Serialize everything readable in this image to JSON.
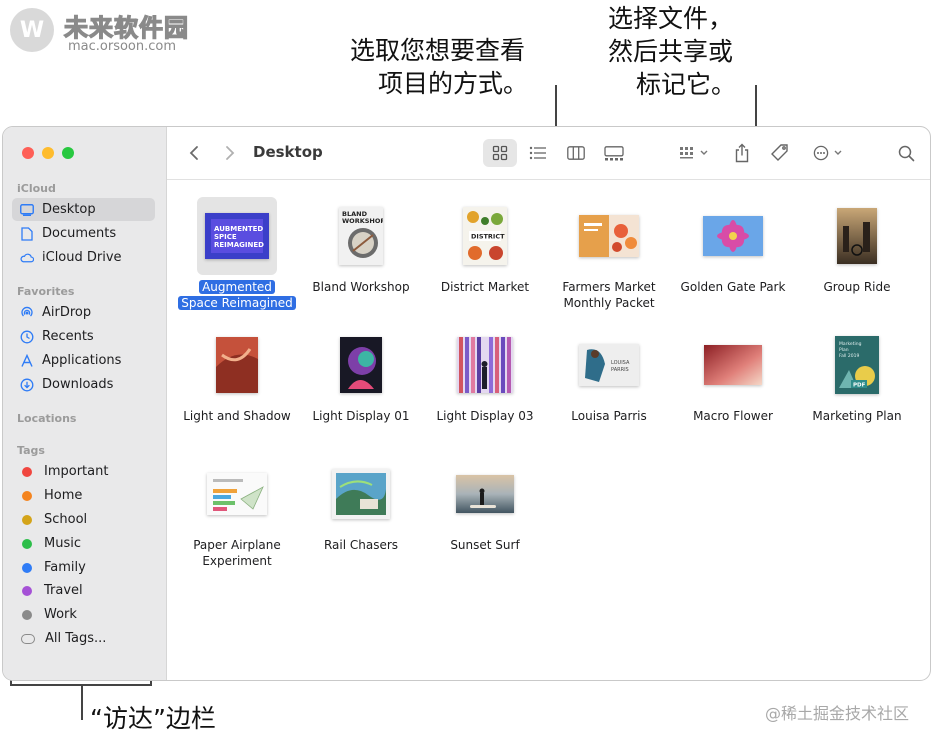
{
  "logo": {
    "title": "未来软件园",
    "url": "mac.orsoon.com"
  },
  "watermark": "@稀土掘金技术社区",
  "callouts": {
    "view": [
      "选取您想要查看",
      "项目的方式。"
    ],
    "share": [
      "选择文件，",
      "然后共享或",
      "标记它。"
    ],
    "sidebar": "“访达”边栏"
  },
  "window": {
    "title": "Desktop",
    "traffic_colors": [
      "#fe5f57",
      "#febc2e",
      "#28c840"
    ]
  },
  "sidebar": {
    "icloud_header": "iCloud",
    "icloud": [
      {
        "label": "Desktop",
        "icon": "desktop-icon"
      },
      {
        "label": "Documents",
        "icon": "document-icon"
      },
      {
        "label": "iCloud Drive",
        "icon": "cloud-icon"
      }
    ],
    "favorites_header": "Favorites",
    "favorites": [
      {
        "label": "AirDrop",
        "icon": "airdrop-icon"
      },
      {
        "label": "Recents",
        "icon": "clock-icon"
      },
      {
        "label": "Applications",
        "icon": "applications-icon"
      },
      {
        "label": "Downloads",
        "icon": "download-icon"
      }
    ],
    "locations_header": "Locations",
    "tags_header": "Tags",
    "tags": [
      {
        "label": "Important",
        "color": "#f0463f"
      },
      {
        "label": "Home",
        "color": "#f4841f"
      },
      {
        "label": "School",
        "color": "#d4a419"
      },
      {
        "label": "Music",
        "color": "#2dbe4a"
      },
      {
        "label": "Family",
        "color": "#2f7cf6"
      },
      {
        "label": "Travel",
        "color": "#a551d6"
      },
      {
        "label": "Work",
        "color": "#8a8a8a"
      }
    ],
    "all_tags": "All Tags..."
  },
  "files": [
    {
      "line1": "Augmented",
      "line2": "Space Reimagined",
      "selected": true
    },
    {
      "line1": "Bland Workshop",
      "line2": ""
    },
    {
      "line1": "District Market",
      "line2": ""
    },
    {
      "line1": "Farmers Market",
      "line2": "Monthly Packet"
    },
    {
      "line1": "Golden Gate Park",
      "line2": ""
    },
    {
      "line1": "Group Ride",
      "line2": ""
    },
    {
      "line1": "Light and Shadow",
      "line2": ""
    },
    {
      "line1": "Light Display 01",
      "line2": ""
    },
    {
      "line1": "Light Display 03",
      "line2": ""
    },
    {
      "line1": "Louisa Parris",
      "line2": ""
    },
    {
      "line1": "Macro Flower",
      "line2": ""
    },
    {
      "line1": "Marketing Plan",
      "line2": ""
    },
    {
      "line1": "Paper Airplane",
      "line2": "Experiment"
    },
    {
      "line1": "Rail Chasers",
      "line2": ""
    },
    {
      "line1": "Sunset Surf",
      "line2": ""
    }
  ],
  "thumbs": {
    "augmented_text": "AUBMENTED SPICE REIMAGINED",
    "bland_text": "BLAND WORKSHOP",
    "district_text": "DISTRICT",
    "louisa_text": "LOUISA PARRIS",
    "marketing_text": "Marketing Plan Fall 2019",
    "pdf_text": "PDF"
  }
}
